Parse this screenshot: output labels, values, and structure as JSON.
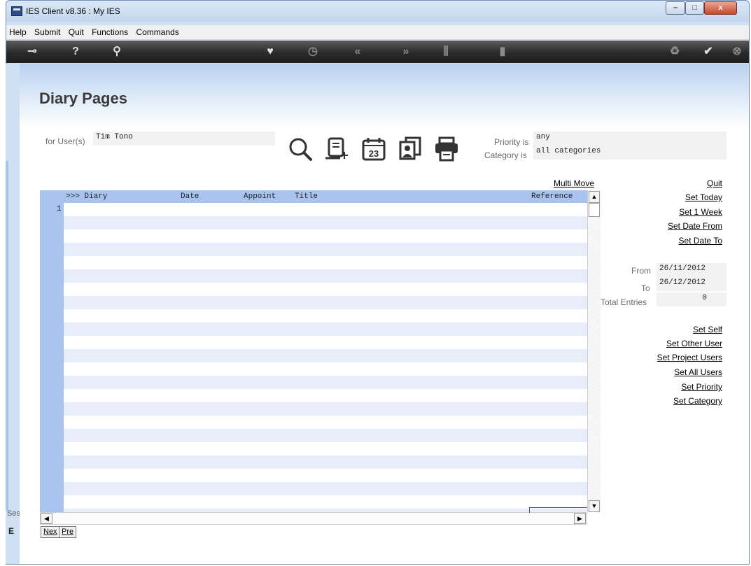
{
  "window": {
    "title": "IES Client v8.36 : My IES",
    "min": "–",
    "max": "□",
    "close": "x"
  },
  "menu": [
    "Help",
    "Submit",
    "Quit",
    "Functions",
    "Commands"
  ],
  "toolbar_icons": [
    "key-icon",
    "help-icon",
    "search-icon",
    "heart-icon",
    "clock-icon",
    "rewind-icon",
    "forward-icon",
    "tools-icon",
    "chip-icon",
    "recycle-icon",
    "check-icon",
    "close-icon"
  ],
  "page": {
    "title": "Diary Pages"
  },
  "filters": {
    "user_label": "for User(s)",
    "user_value": "Tim Tono",
    "priority_label": "Priority is",
    "priority_value": "any",
    "category_label": "Category is",
    "category_value": "all categories"
  },
  "grid": {
    "columns": [
      ">>> Diary",
      "Date",
      "Appoint",
      "Title",
      "Reference"
    ],
    "row_numbers": [
      "1"
    ]
  },
  "links": {
    "multi_move": "Multi Move",
    "quit": "Quit",
    "set_today": "Set Today",
    "set_1_week": "Set 1 Week",
    "set_date_from": "Set Date From",
    "set_date_to": "Set Date To",
    "set_self": "Set Self",
    "set_other_user": "Set Other User",
    "set_project_users": "Set Project Users",
    "set_all_users": "Set All Users",
    "set_priority": "Set Priority",
    "set_category": "Set Category"
  },
  "range": {
    "from_label": "From",
    "from_value": "26/11/2012",
    "to_label": "To",
    "to_value": "26/12/2012",
    "total_label": "Total Entries",
    "total_value": "0"
  },
  "nav": {
    "next": "Nex",
    "prev": "Pre"
  },
  "side": {
    "ses": "Ses",
    "icon": "E"
  }
}
